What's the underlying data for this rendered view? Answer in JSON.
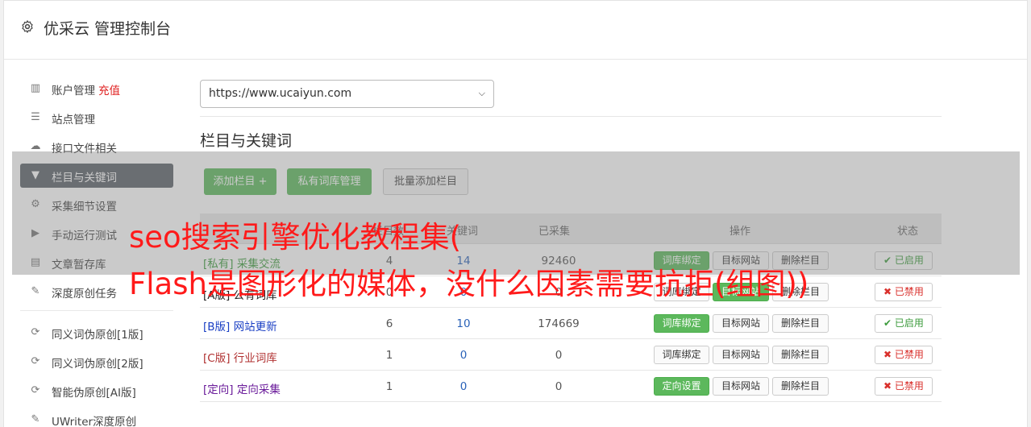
{
  "header": {
    "title": "优采云 管理控制台"
  },
  "sidebar": {
    "group1": [
      {
        "label": "账户管理",
        "extra": "充值",
        "icon": "bar-chart-icon"
      },
      {
        "label": "站点管理",
        "icon": "server-icon"
      },
      {
        "label": "接口文件相关",
        "icon": "cloud-upload-icon"
      },
      {
        "label": "栏目与关键词",
        "icon": "filter-icon",
        "active": true
      },
      {
        "label": "采集细节设置",
        "icon": "cogs-icon"
      },
      {
        "label": "手动运行测试",
        "icon": "play-circle-icon"
      },
      {
        "label": "文章暂存库",
        "icon": "database-icon"
      },
      {
        "label": "深度原创任务",
        "icon": "edit-icon"
      }
    ],
    "group2": [
      {
        "label": "同义词伪原创[1版]",
        "icon": "refresh-icon"
      },
      {
        "label": "同义词伪原创[2版]",
        "icon": "refresh-icon"
      },
      {
        "label": "智能伪原创[AI版]",
        "icon": "refresh-icon"
      },
      {
        "label": "UWriter深度原创",
        "icon": "edit-icon"
      }
    ]
  },
  "site_select": {
    "value": "https://www.ucaiyun.com"
  },
  "section": {
    "title": "栏目与关键词"
  },
  "buttons": {
    "add_column": "添加栏目 +",
    "private_lib": "私有词库管理",
    "batch_add": "批量添加栏目"
  },
  "table": {
    "headers": {
      "col2": "栏目数",
      "col3": "关键词",
      "collected": "已采集",
      "ops": "操作",
      "status": "状态"
    },
    "rows": [
      {
        "name": "[私有] 采集交流",
        "name_color": "#3c9b3c",
        "c1": "4",
        "c2": "14",
        "collected": "92460",
        "op1": "词库绑定",
        "op1_green": true,
        "op2": "目标网站",
        "op3": "删除栏目",
        "status": "已启用",
        "status_on": true
      },
      {
        "name": "[A版] 公有词库",
        "name_color": "#222222",
        "c1": "0",
        "c2": "0",
        "collected": "0",
        "op1": "词库绑定",
        "op1_green": false,
        "op2": "目标网站",
        "op2_green": true,
        "op3": "删除栏目",
        "status": "已禁用",
        "status_on": false
      },
      {
        "name": "[B版] 网站更新",
        "name_color": "#1a3fc4",
        "c1": "6",
        "c2": "10",
        "collected": "174669",
        "op1": "词库绑定",
        "op1_green": true,
        "op2": "目标网站",
        "op3": "删除栏目",
        "status": "已启用",
        "status_on": true
      },
      {
        "name": "[C版] 行业词库",
        "name_color": "#b03030",
        "c1": "1",
        "c2": "0",
        "collected": "0",
        "op1": "词库绑定",
        "op1_green": false,
        "op2": "目标网站",
        "op3": "删除栏目",
        "status": "已禁用",
        "status_on": false
      },
      {
        "name": "[定向] 定向采集",
        "name_color": "#6a1b9a",
        "c1": "1",
        "c2": "0",
        "collected": "0",
        "op1": "定向设置",
        "op1_green": true,
        "op2": "目标网站",
        "op3": "删除栏目",
        "status": "已禁用",
        "status_on": false
      }
    ]
  },
  "overlay": {
    "line1": "seo搜索引擎优化教程集(",
    "line2": "Flash是图形化的媒体，没什么因素需要抗拒(组图))"
  }
}
